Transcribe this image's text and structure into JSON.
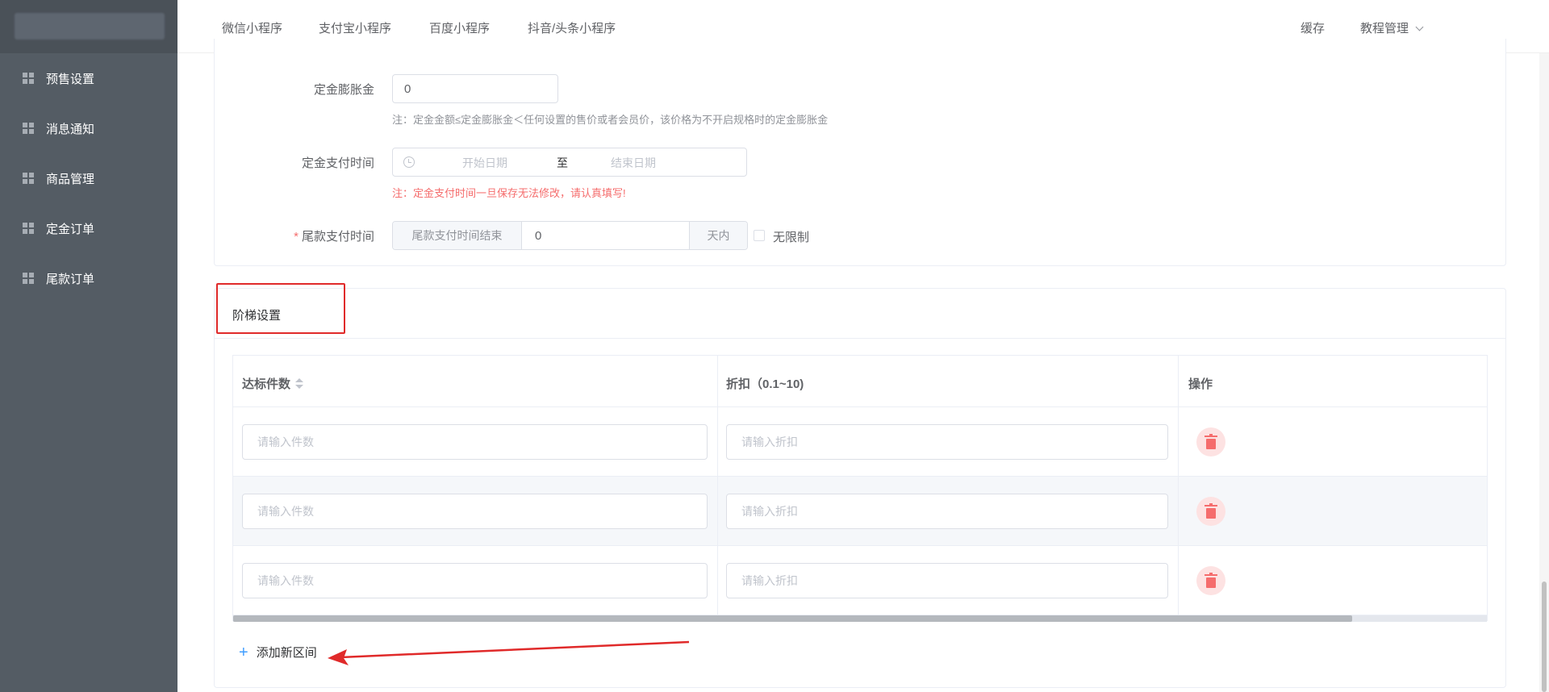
{
  "sidebar": {
    "items": [
      {
        "label": "预售设置",
        "icon": "grid-icon"
      },
      {
        "label": "消息通知",
        "icon": "grid-icon"
      },
      {
        "label": "商品管理",
        "icon": "grid-icon"
      },
      {
        "label": "定金订单",
        "icon": "grid-icon"
      },
      {
        "label": "尾款订单",
        "icon": "grid-icon"
      }
    ]
  },
  "topnav": {
    "tabs": [
      "微信小程序",
      "支付宝小程序",
      "百度小程序",
      "抖音/头条小程序"
    ],
    "cache": "缓存",
    "tutorial": "教程管理"
  },
  "form": {
    "deposit_expand_label": "定金膨胀金",
    "deposit_expand_value": "0",
    "deposit_expand_note": "注：定金金额≤定金膨胀金＜任何设置的售价或者会员价，该价格为不开启规格时的定金膨胀金",
    "deposit_time_label": "定金支付时间",
    "start_date_placeholder": "开始日期",
    "date_separator": "至",
    "end_date_placeholder": "结束日期",
    "deposit_time_note": "注：定金支付时间一旦保存无法修改，请认真填写!",
    "final_time_required": "*",
    "final_time_label": "尾款支付时间",
    "final_time_prepend": "尾款支付时间结束",
    "final_time_value": "0",
    "final_time_append": "天内",
    "unlimited_label": "无限制",
    "unlimited_checked": false
  },
  "tier": {
    "title": "阶梯设置",
    "columns": [
      "达标件数",
      "折扣（0.1~10)",
      "操作"
    ],
    "rows": [
      {
        "qty_placeholder": "请输入件数",
        "discount_placeholder": "请输入折扣"
      },
      {
        "qty_placeholder": "请输入件数",
        "discount_placeholder": "请输入折扣"
      },
      {
        "qty_placeholder": "请输入件数",
        "discount_placeholder": "请输入折扣"
      }
    ],
    "add_label": "添加新区间"
  },
  "colors": {
    "sidebar_bg": "#545c64",
    "danger": "#f56c6c",
    "primary": "#409eff",
    "annotation_red": "#e02a2a"
  }
}
